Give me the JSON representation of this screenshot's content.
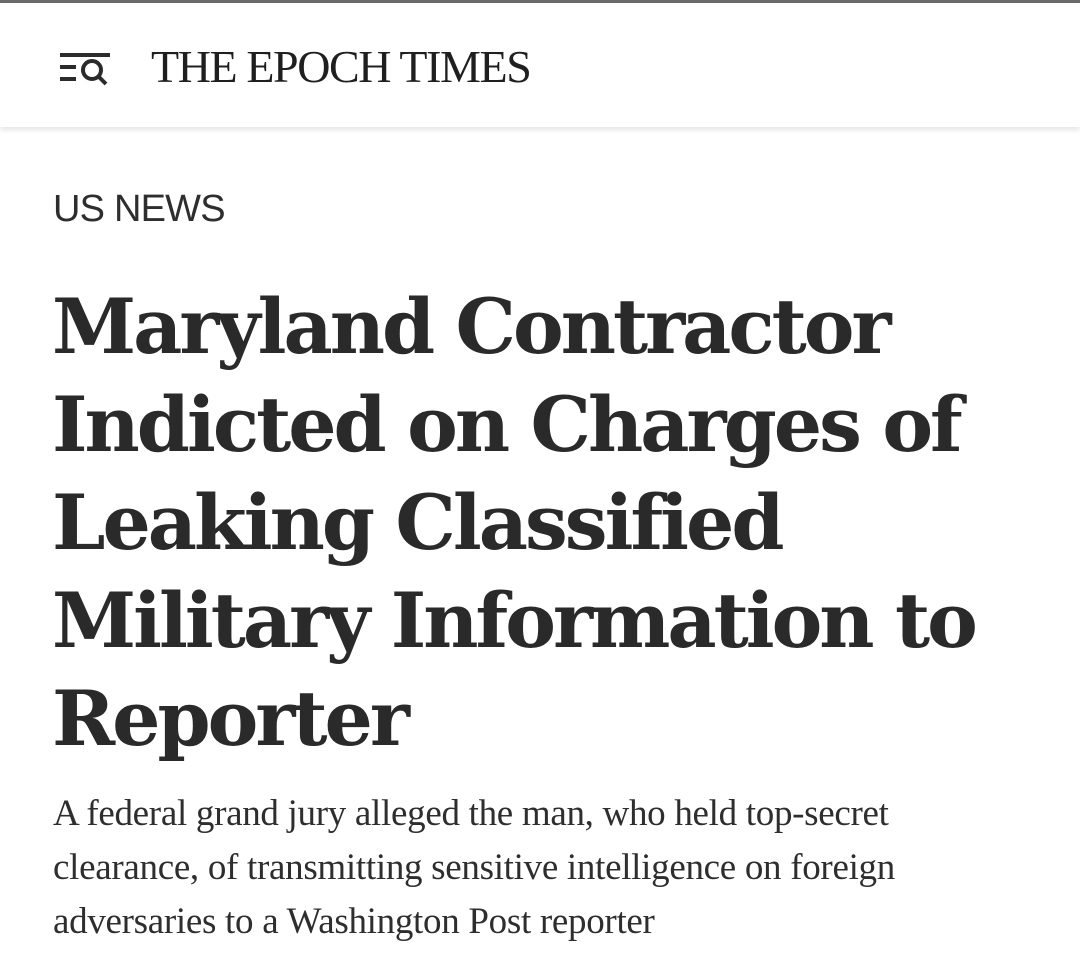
{
  "header": {
    "menu_icon": "menu-search-icon",
    "masthead": "THE EPOCH TIMES"
  },
  "article": {
    "section": "US NEWS",
    "headline_lines": [
      "Maryland Contractor",
      "Indicted on Charges of",
      "Leaking Classified",
      "Military Information to",
      "Reporter"
    ],
    "dek_lines": [
      "A federal grand jury alleged the man, who held top-secret",
      "clearance, of transmitting sensitive intelligence on foreign",
      "adversaries to a Washington Post reporter"
    ]
  },
  "colors": {
    "text": "#2a2a2a",
    "background": "#ffffff",
    "top_rule": "#6a6a6a"
  }
}
